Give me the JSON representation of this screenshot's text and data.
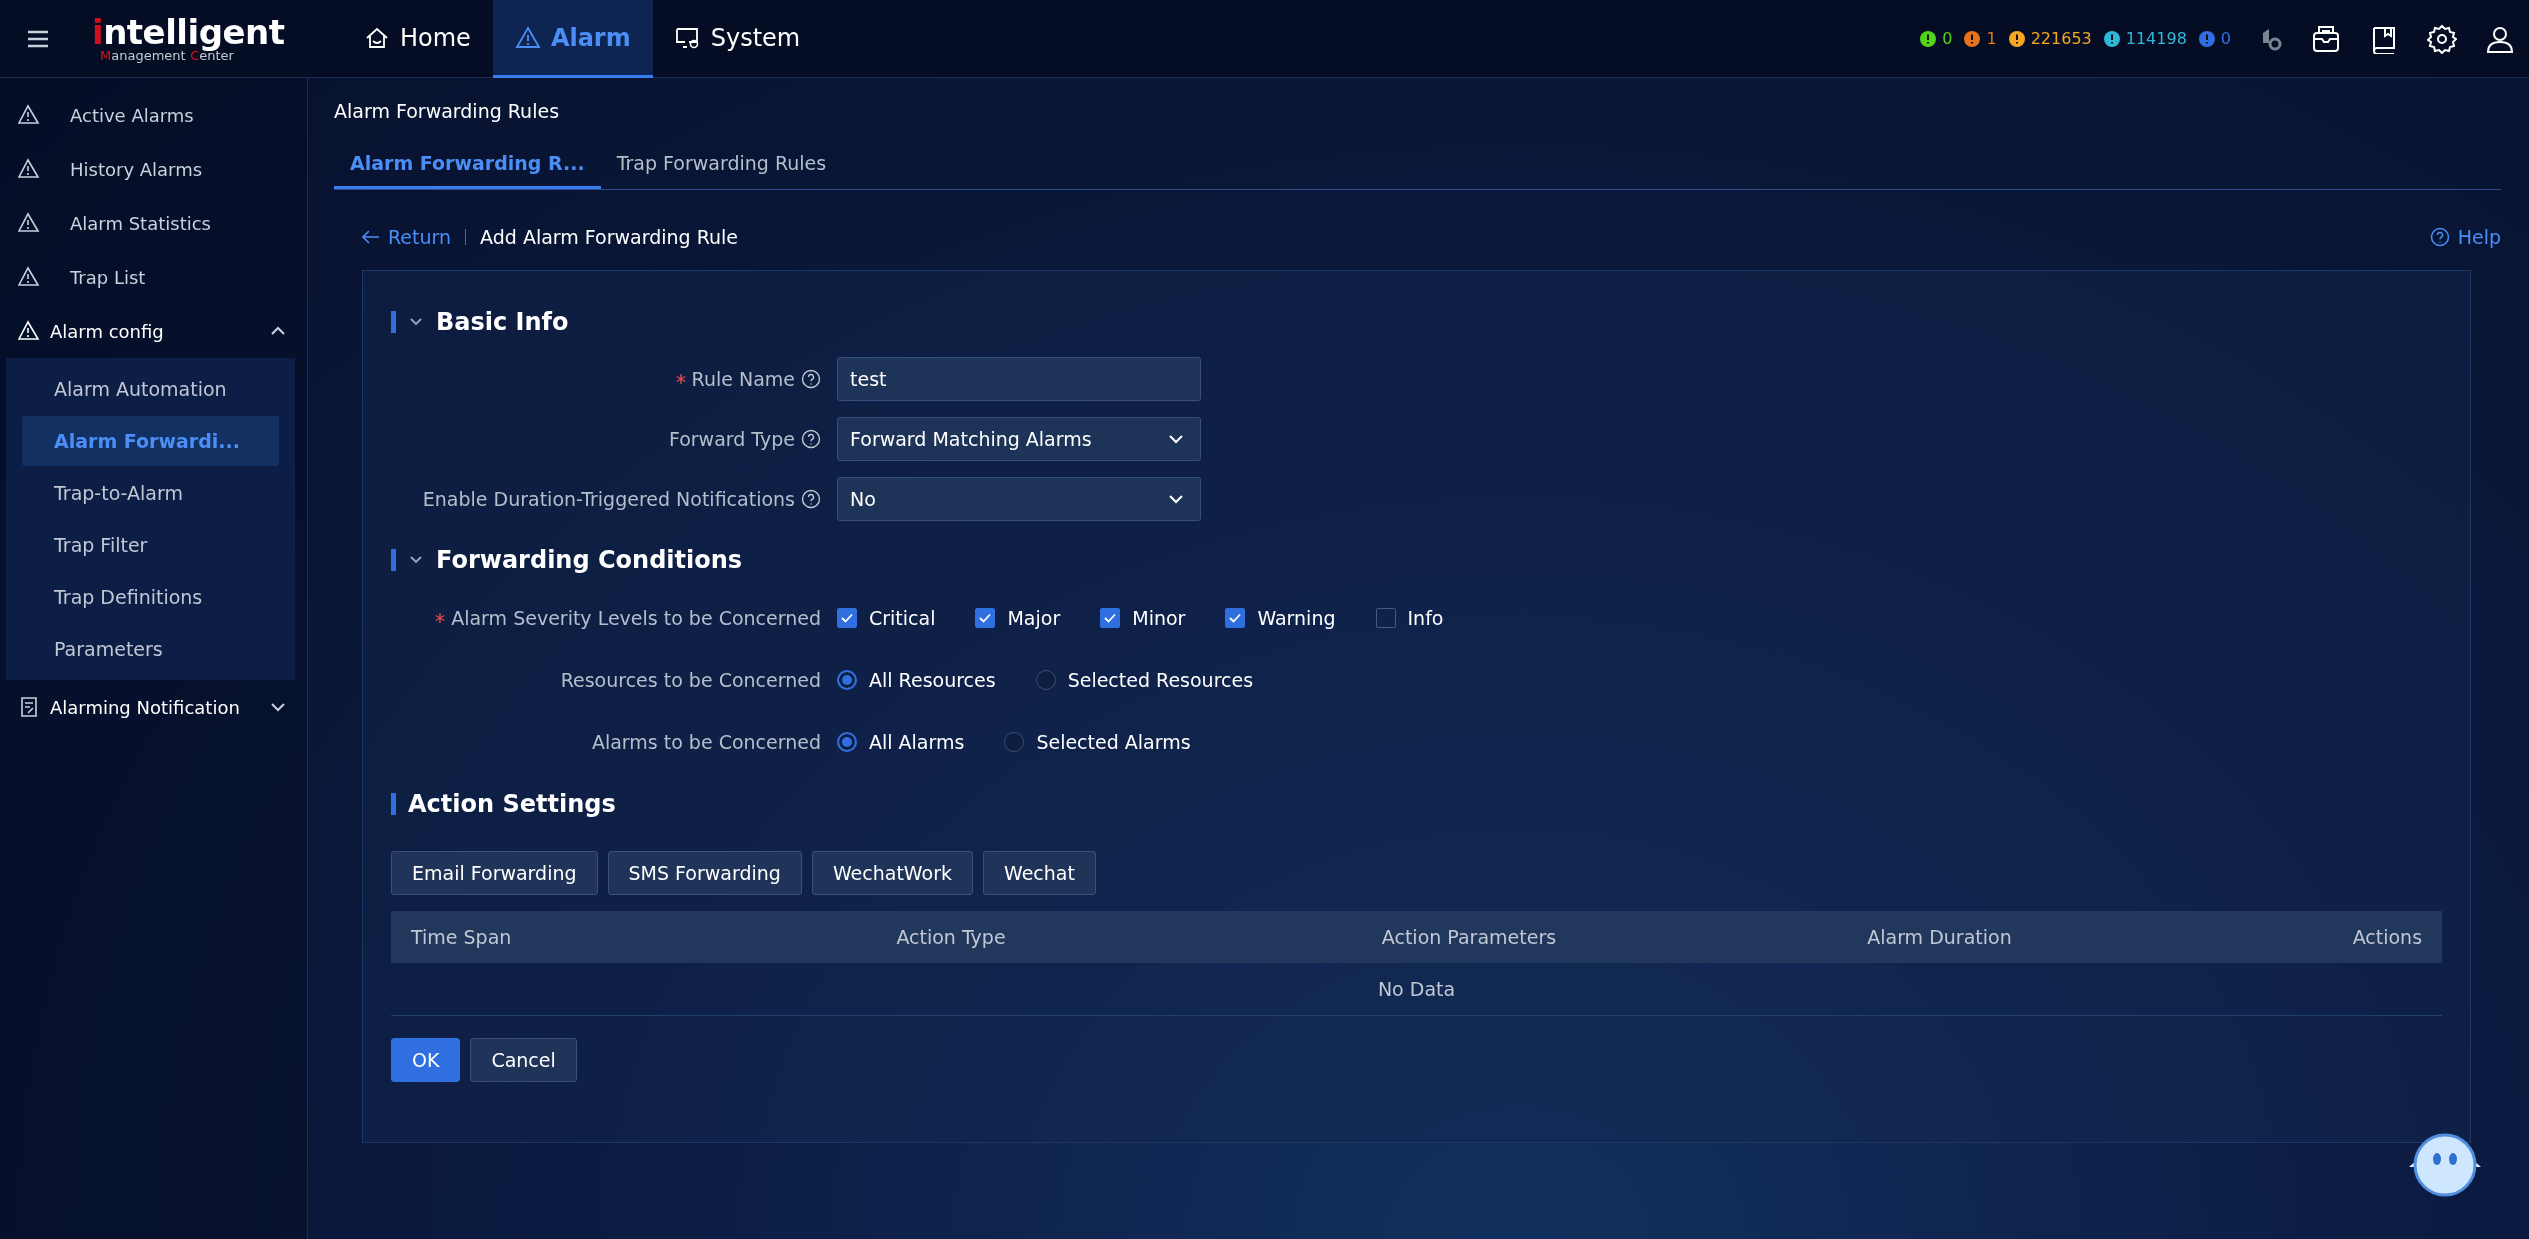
{
  "header": {
    "logo": {
      "title": "intelligent",
      "subtitle": [
        "Management",
        "Center"
      ]
    },
    "nav": [
      {
        "label": "Home",
        "selected": false
      },
      {
        "label": "Alarm",
        "selected": true
      },
      {
        "label": "System",
        "selected": false
      }
    ],
    "alarm_counts": [
      {
        "count": "0",
        "color": "#52d41a"
      },
      {
        "count": "1",
        "color": "#e8711c"
      },
      {
        "count": "221653",
        "color": "#f5a623"
      },
      {
        "count": "114198",
        "color": "#2fb8d8"
      },
      {
        "count": "0",
        "color": "#2f6fe0"
      }
    ]
  },
  "sidebar": {
    "items": [
      {
        "label": "Active Alarms",
        "selected": false
      },
      {
        "label": "History Alarms",
        "selected": false
      },
      {
        "label": "Alarm Statistics",
        "selected": false
      },
      {
        "label": "Trap List",
        "selected": false
      },
      {
        "label": "Alarm config",
        "expanded": true,
        "children": [
          {
            "label": "Alarm Automation",
            "selected": false
          },
          {
            "label": "Alarm Forwardi...",
            "selected": true
          },
          {
            "label": "Trap-to-Alarm",
            "selected": false
          },
          {
            "label": "Trap Filter",
            "selected": false
          },
          {
            "label": "Trap Definitions",
            "selected": false
          },
          {
            "label": "Parameters",
            "selected": false
          }
        ]
      },
      {
        "label": "Alarming Notification",
        "expanded": false
      }
    ]
  },
  "page": {
    "title": "Alarm Forwarding Rules",
    "tabs": [
      {
        "label": "Alarm Forwarding R...",
        "selected": true
      },
      {
        "label": "Trap Forwarding Rules",
        "selected": false
      }
    ],
    "return_link": "Return",
    "heading": "Add Alarm Forwarding Rule",
    "help": "Help"
  },
  "basic_info": {
    "title": "Basic Info",
    "fields": [
      {
        "label": "Rule Name",
        "required": true,
        "kind": "input",
        "value": "test"
      },
      {
        "label": "Forward Type",
        "required": false,
        "kind": "select",
        "value": "Forward Matching Alarms"
      },
      {
        "label": "Enable Duration-Triggered Notifications",
        "required": false,
        "kind": "select",
        "value": "No"
      }
    ]
  },
  "forwarding_conditions": {
    "title": "Forwarding Conditions",
    "severity": {
      "label": "Alarm Severity Levels to be Concerned",
      "required": true,
      "options": [
        {
          "label": "Critical",
          "checked": true
        },
        {
          "label": "Major",
          "checked": true
        },
        {
          "label": "Minor",
          "checked": true
        },
        {
          "label": "Warning",
          "checked": true
        },
        {
          "label": "Info",
          "checked": false
        }
      ]
    },
    "radios": [
      {
        "label": "Resources to be Concerned",
        "options": [
          {
            "label": "All Resources",
            "selected": true
          },
          {
            "label": "Selected Resources",
            "selected": false
          }
        ]
      },
      {
        "label": "Alarms to be Concerned",
        "options": [
          {
            "label": "All Alarms",
            "selected": true
          },
          {
            "label": "Selected Alarms",
            "selected": false
          }
        ]
      }
    ]
  },
  "action_settings": {
    "title": "Action Settings",
    "buttons": [
      "Email Forwarding",
      "SMS Forwarding",
      "WechatWork",
      "Wechat"
    ],
    "table": {
      "columns": [
        "Time Span",
        "Action Type",
        "Action Parameters",
        "Alarm Duration",
        "Actions"
      ],
      "empty": "No Data"
    }
  },
  "footer_buttons": [
    {
      "label": "OK",
      "kind": "primary"
    },
    {
      "label": "Cancel",
      "kind": "default"
    }
  ]
}
